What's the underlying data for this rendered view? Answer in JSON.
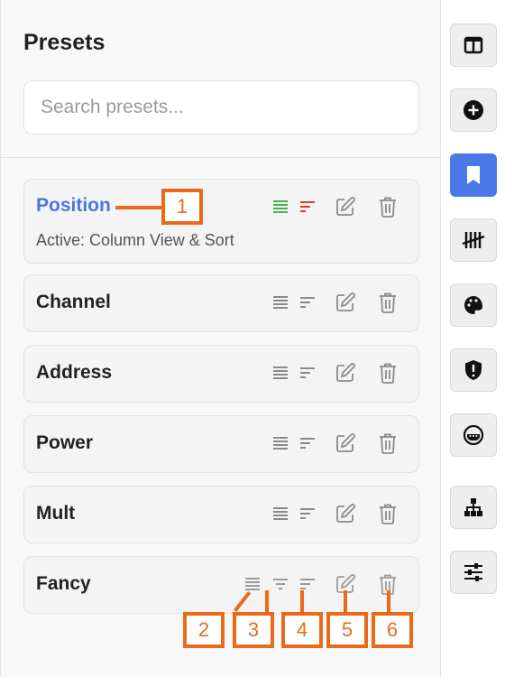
{
  "panel": {
    "title": "Presets",
    "search_placeholder": "Search presets..."
  },
  "presets": [
    {
      "name": "Position",
      "subtitle": "Active: Column View & Sort",
      "active": true
    },
    {
      "name": "Channel"
    },
    {
      "name": "Address"
    },
    {
      "name": "Power"
    },
    {
      "name": "Mult"
    },
    {
      "name": "Fancy"
    }
  ],
  "annotations": [
    "1",
    "2",
    "3",
    "4",
    "5",
    "6"
  ],
  "sidebar": {
    "items": [
      {
        "icon": "columns-icon",
        "active": false
      },
      {
        "icon": "add-circle-icon",
        "active": false
      },
      {
        "icon": "bookmark-icon",
        "active": true
      },
      {
        "icon": "tally-icon",
        "active": false
      },
      {
        "icon": "palette-icon",
        "active": false
      },
      {
        "icon": "shield-alert-icon",
        "active": false
      },
      {
        "icon": "connector-icon",
        "active": false
      },
      {
        "icon": "hierarchy-icon",
        "active": false
      },
      {
        "icon": "sliders-icon",
        "active": false
      }
    ]
  },
  "colors": {
    "accent": "#4a78e8",
    "active_name": "#4a78e0",
    "column_active": "#4caf50",
    "sort_active": "#e53935",
    "annotation": "#ea6a1a"
  }
}
